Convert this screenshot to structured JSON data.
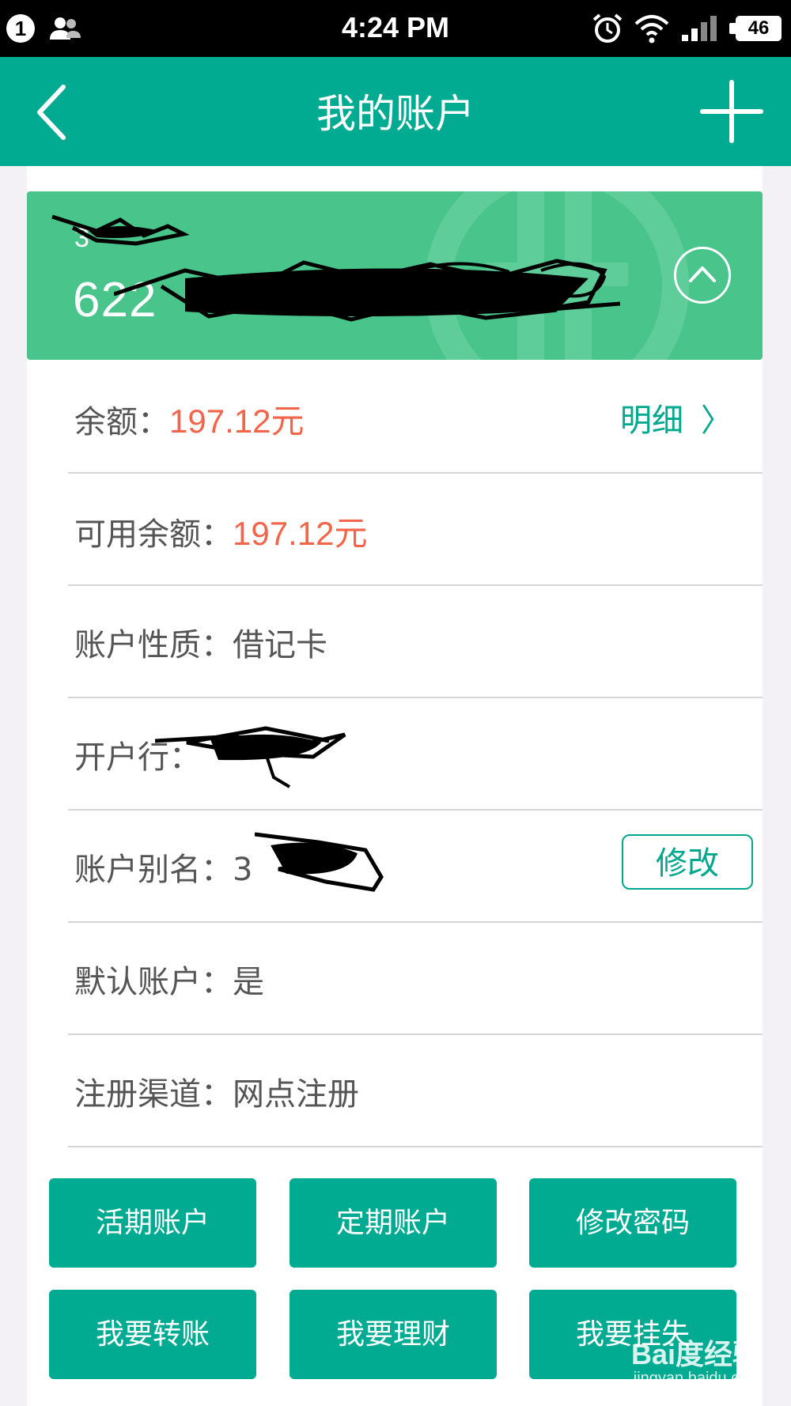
{
  "status_bar": {
    "notification_count": "1",
    "time": "4:24 PM",
    "battery": "46"
  },
  "header": {
    "title": "我的账户"
  },
  "account_card": {
    "alias_partial": "3",
    "number_partial": "622"
  },
  "rows": {
    "balance": {
      "label": "余额：",
      "value": "197.12元",
      "detail_label": "明细"
    },
    "available": {
      "label": "可用余额：",
      "value": "197.12元"
    },
    "type": {
      "label": "账户性质：",
      "value": "借记卡"
    },
    "bank": {
      "label": "开户行："
    },
    "alias": {
      "label": "账户别名：",
      "value_partial": "3",
      "edit_label": "修改"
    },
    "default": {
      "label": "默认账户：",
      "value": "是"
    },
    "channel": {
      "label": "注册渠道：",
      "value": "网点注册"
    }
  },
  "actions": [
    {
      "label": "活期账户"
    },
    {
      "label": "定期账户"
    },
    {
      "label": "修改密码"
    },
    {
      "label": "我要转账"
    },
    {
      "label": "我要理财"
    },
    {
      "label": "我要挂失"
    }
  ],
  "watermark": {
    "brand": "Bai度经验",
    "url": "jingyan.baidu.com"
  },
  "colors": {
    "primary": "#00ab92",
    "card": "#49c48b",
    "amount": "#f2654b"
  }
}
